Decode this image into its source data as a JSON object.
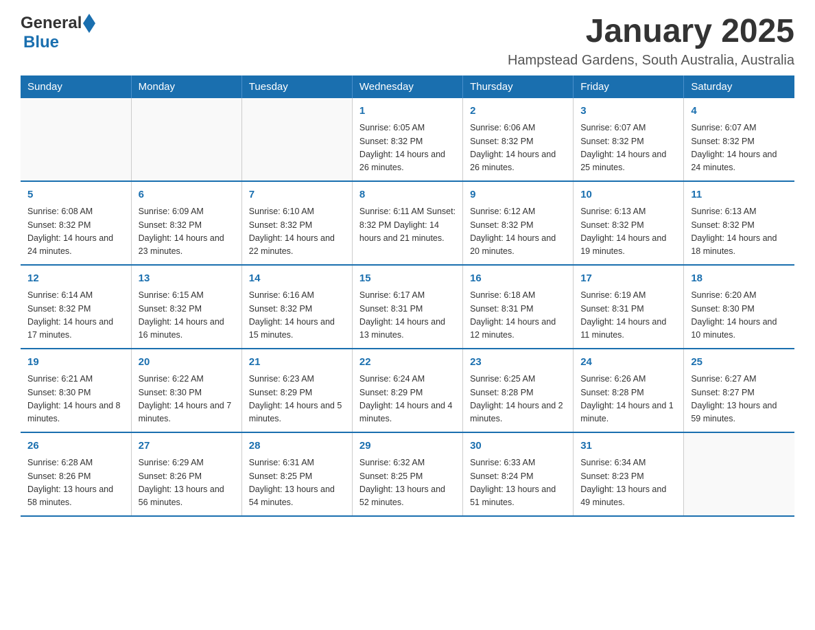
{
  "logo": {
    "general": "General",
    "blue": "Blue"
  },
  "title": "January 2025",
  "subtitle": "Hampstead Gardens, South Australia, Australia",
  "days_of_week": [
    "Sunday",
    "Monday",
    "Tuesday",
    "Wednesday",
    "Thursday",
    "Friday",
    "Saturday"
  ],
  "weeks": [
    [
      {
        "day": "",
        "info": ""
      },
      {
        "day": "",
        "info": ""
      },
      {
        "day": "",
        "info": ""
      },
      {
        "day": "1",
        "info": "Sunrise: 6:05 AM\nSunset: 8:32 PM\nDaylight: 14 hours and 26 minutes."
      },
      {
        "day": "2",
        "info": "Sunrise: 6:06 AM\nSunset: 8:32 PM\nDaylight: 14 hours and 26 minutes."
      },
      {
        "day": "3",
        "info": "Sunrise: 6:07 AM\nSunset: 8:32 PM\nDaylight: 14 hours and 25 minutes."
      },
      {
        "day": "4",
        "info": "Sunrise: 6:07 AM\nSunset: 8:32 PM\nDaylight: 14 hours and 24 minutes."
      }
    ],
    [
      {
        "day": "5",
        "info": "Sunrise: 6:08 AM\nSunset: 8:32 PM\nDaylight: 14 hours and 24 minutes."
      },
      {
        "day": "6",
        "info": "Sunrise: 6:09 AM\nSunset: 8:32 PM\nDaylight: 14 hours and 23 minutes."
      },
      {
        "day": "7",
        "info": "Sunrise: 6:10 AM\nSunset: 8:32 PM\nDaylight: 14 hours and 22 minutes."
      },
      {
        "day": "8",
        "info": "Sunrise: 6:11 AM\nSunset: 8:32 PM\nDaylight: 14 hours and 21 minutes."
      },
      {
        "day": "9",
        "info": "Sunrise: 6:12 AM\nSunset: 8:32 PM\nDaylight: 14 hours and 20 minutes."
      },
      {
        "day": "10",
        "info": "Sunrise: 6:13 AM\nSunset: 8:32 PM\nDaylight: 14 hours and 19 minutes."
      },
      {
        "day": "11",
        "info": "Sunrise: 6:13 AM\nSunset: 8:32 PM\nDaylight: 14 hours and 18 minutes."
      }
    ],
    [
      {
        "day": "12",
        "info": "Sunrise: 6:14 AM\nSunset: 8:32 PM\nDaylight: 14 hours and 17 minutes."
      },
      {
        "day": "13",
        "info": "Sunrise: 6:15 AM\nSunset: 8:32 PM\nDaylight: 14 hours and 16 minutes."
      },
      {
        "day": "14",
        "info": "Sunrise: 6:16 AM\nSunset: 8:32 PM\nDaylight: 14 hours and 15 minutes."
      },
      {
        "day": "15",
        "info": "Sunrise: 6:17 AM\nSunset: 8:31 PM\nDaylight: 14 hours and 13 minutes."
      },
      {
        "day": "16",
        "info": "Sunrise: 6:18 AM\nSunset: 8:31 PM\nDaylight: 14 hours and 12 minutes."
      },
      {
        "day": "17",
        "info": "Sunrise: 6:19 AM\nSunset: 8:31 PM\nDaylight: 14 hours and 11 minutes."
      },
      {
        "day": "18",
        "info": "Sunrise: 6:20 AM\nSunset: 8:30 PM\nDaylight: 14 hours and 10 minutes."
      }
    ],
    [
      {
        "day": "19",
        "info": "Sunrise: 6:21 AM\nSunset: 8:30 PM\nDaylight: 14 hours and 8 minutes."
      },
      {
        "day": "20",
        "info": "Sunrise: 6:22 AM\nSunset: 8:30 PM\nDaylight: 14 hours and 7 minutes."
      },
      {
        "day": "21",
        "info": "Sunrise: 6:23 AM\nSunset: 8:29 PM\nDaylight: 14 hours and 5 minutes."
      },
      {
        "day": "22",
        "info": "Sunrise: 6:24 AM\nSunset: 8:29 PM\nDaylight: 14 hours and 4 minutes."
      },
      {
        "day": "23",
        "info": "Sunrise: 6:25 AM\nSunset: 8:28 PM\nDaylight: 14 hours and 2 minutes."
      },
      {
        "day": "24",
        "info": "Sunrise: 6:26 AM\nSunset: 8:28 PM\nDaylight: 14 hours and 1 minute."
      },
      {
        "day": "25",
        "info": "Sunrise: 6:27 AM\nSunset: 8:27 PM\nDaylight: 13 hours and 59 minutes."
      }
    ],
    [
      {
        "day": "26",
        "info": "Sunrise: 6:28 AM\nSunset: 8:26 PM\nDaylight: 13 hours and 58 minutes."
      },
      {
        "day": "27",
        "info": "Sunrise: 6:29 AM\nSunset: 8:26 PM\nDaylight: 13 hours and 56 minutes."
      },
      {
        "day": "28",
        "info": "Sunrise: 6:31 AM\nSunset: 8:25 PM\nDaylight: 13 hours and 54 minutes."
      },
      {
        "day": "29",
        "info": "Sunrise: 6:32 AM\nSunset: 8:25 PM\nDaylight: 13 hours and 52 minutes."
      },
      {
        "day": "30",
        "info": "Sunrise: 6:33 AM\nSunset: 8:24 PM\nDaylight: 13 hours and 51 minutes."
      },
      {
        "day": "31",
        "info": "Sunrise: 6:34 AM\nSunset: 8:23 PM\nDaylight: 13 hours and 49 minutes."
      },
      {
        "day": "",
        "info": ""
      }
    ]
  ]
}
